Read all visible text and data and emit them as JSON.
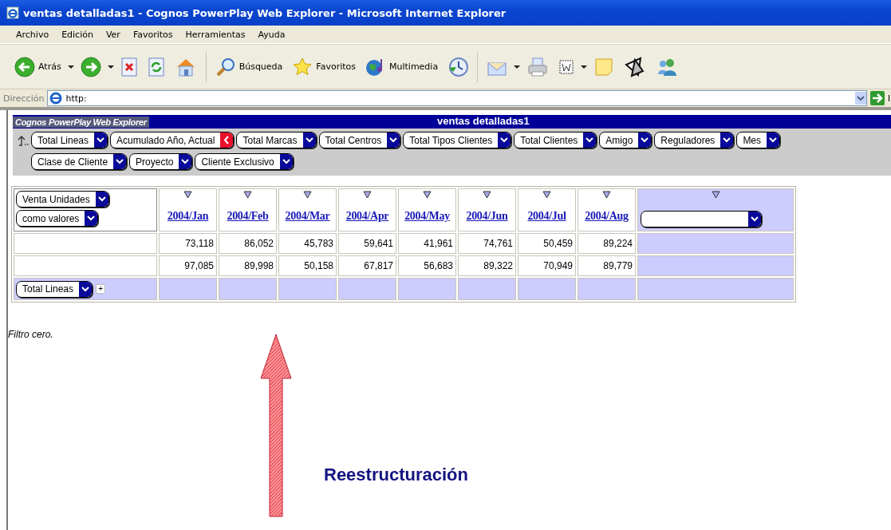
{
  "window": {
    "title": "ventas detalladas1 - Cognos PowerPlay Web Explorer - Microsoft Internet Explorer"
  },
  "menu": [
    "Archivo",
    "Edición",
    "Ver",
    "Favoritos",
    "Herramientas",
    "Ayuda"
  ],
  "toolbar": [
    {
      "kind": "back",
      "label": "Atrás",
      "dropdown": true
    },
    {
      "kind": "forward",
      "dropdown": true
    },
    {
      "kind": "stop"
    },
    {
      "kind": "refresh"
    },
    {
      "kind": "home"
    },
    {
      "kind": "sep"
    },
    {
      "kind": "search",
      "label": "Búsqueda"
    },
    {
      "kind": "favorites",
      "label": "Favoritos"
    },
    {
      "kind": "media",
      "label": "Multimedia"
    },
    {
      "kind": "history"
    },
    {
      "kind": "sep"
    },
    {
      "kind": "mail",
      "dropdown": true
    },
    {
      "kind": "print"
    },
    {
      "kind": "word",
      "dropdown": true
    },
    {
      "kind": "note"
    },
    {
      "kind": "tool"
    },
    {
      "kind": "messenger"
    }
  ],
  "address_bar": {
    "label": "Dirección",
    "value": "http:",
    "go_label": "I"
  },
  "app_header": {
    "brand": "Cognos PowerPlay Web Explorer",
    "report_title": "ventas detalladas1"
  },
  "filter_rows": [
    [
      {
        "label": "Total Lineas",
        "kind": "dropdown"
      },
      {
        "label": "Acumulado Año, Actual",
        "kind": "back"
      },
      {
        "label": "Total Marcas",
        "kind": "dropdown"
      },
      {
        "label": "Total Centros",
        "kind": "dropdown"
      },
      {
        "label": "Total Tipos Clientes",
        "kind": "dropdown"
      },
      {
        "label": "Total Clientes",
        "kind": "dropdown"
      },
      {
        "label": "Amigo",
        "kind": "dropdown"
      },
      {
        "label": "Reguladores",
        "kind": "dropdown"
      },
      {
        "label": "Mes",
        "kind": "dropdown"
      }
    ],
    [
      {
        "label": "Clase de Cliente",
        "kind": "dropdown"
      },
      {
        "label": "Proyecto",
        "kind": "dropdown"
      },
      {
        "label": "Cliente Exclusivo",
        "kind": "dropdown"
      }
    ]
  ],
  "table": {
    "measure": "Venta Unidades",
    "display": "como valores",
    "columns": [
      {
        "label": "2004/Jan",
        "kind": "link"
      },
      {
        "label": "2004/Feb",
        "kind": "link"
      },
      {
        "label": "2004/Mar",
        "kind": "link"
      },
      {
        "label": "2004/Apr",
        "kind": "link"
      },
      {
        "label": "2004/May",
        "kind": "link"
      },
      {
        "label": "2004/Jun",
        "kind": "link"
      },
      {
        "label": "2004/Jul",
        "kind": "link"
      },
      {
        "label": "2004/Aug",
        "kind": "link"
      },
      {
        "kind": "dropdown"
      }
    ],
    "rows": [
      [
        "73,118",
        "86,052",
        "45,783",
        "59,641",
        "41,961",
        "74,761",
        "50,459",
        "89,224"
      ],
      [
        "97,085",
        "89,998",
        "50,158",
        "67,817",
        "56,683",
        "89,322",
        "70,949",
        "89,779"
      ]
    ],
    "row_dimension": "Total Lineas",
    "add_label": "+"
  },
  "note": "Filtro cero.",
  "annotation": {
    "label": "Reestructuración"
  }
}
